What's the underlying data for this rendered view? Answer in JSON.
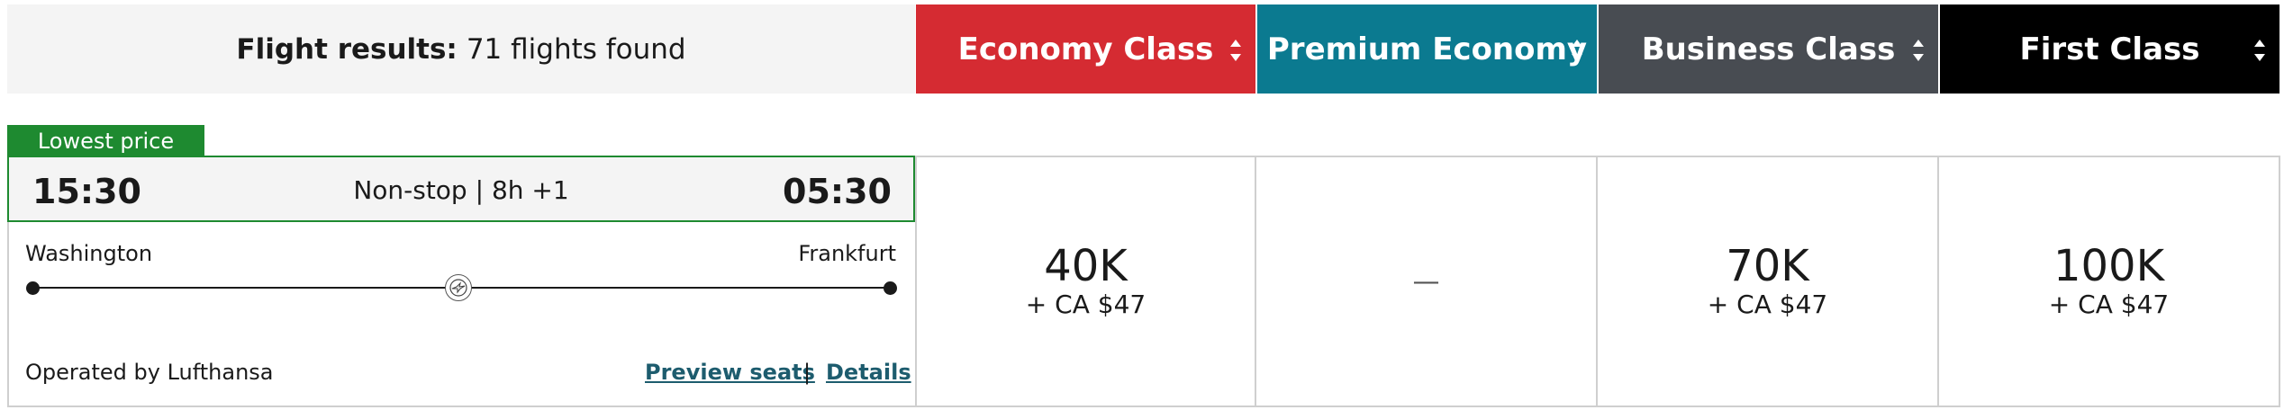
{
  "results": {
    "label": "Flight results:",
    "count_text": "71 flights found"
  },
  "classes": [
    {
      "label": "Economy Class",
      "color": "#d52b32"
    },
    {
      "label": "Premium Economy",
      "color": "#0b7a90"
    },
    {
      "label": "Business Class",
      "color": "#484c52"
    },
    {
      "label": "First Class",
      "color": "#000000"
    }
  ],
  "flight": {
    "badge": "Lowest price",
    "depart_time": "15:30",
    "arrive_time": "05:30",
    "stops_duration": "Non-stop | 8h +1",
    "origin": "Washington",
    "destination": "Frankfurt",
    "operated_by": "Operated by Lufthansa",
    "preview_seats": "Preview seats",
    "separator": "|",
    "details": "Details",
    "prices": [
      {
        "points": "40K",
        "cash": "+ CA $47"
      },
      {
        "none": "—"
      },
      {
        "points": "70K",
        "cash": "+ CA $47"
      },
      {
        "points": "100K",
        "cash": "+ CA $47"
      }
    ]
  },
  "icons": {
    "sort": "sort-arrows-icon",
    "airline": "lufthansa-crane-icon"
  }
}
